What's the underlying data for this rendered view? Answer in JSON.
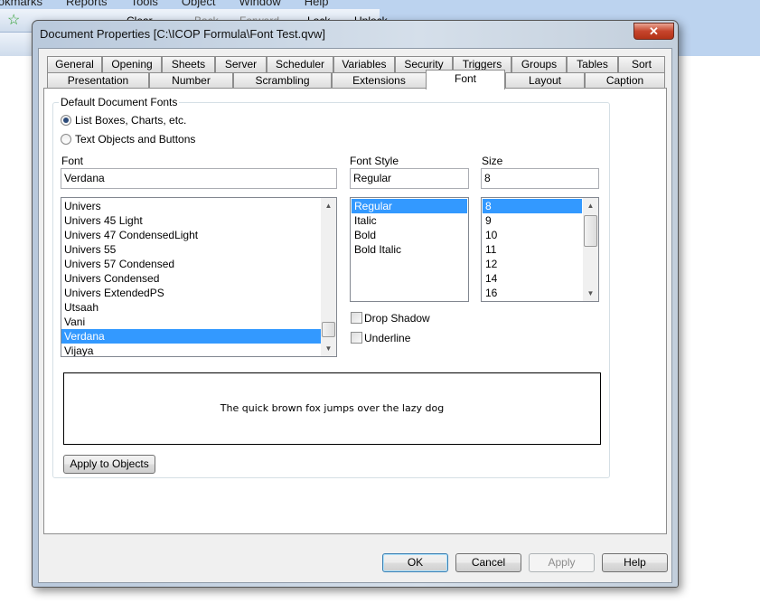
{
  "app": {
    "menu": [
      "Bookmarks",
      "Reports",
      "Tools",
      "Object",
      "Window",
      "Help"
    ],
    "toolbar": {
      "clear": "Clear",
      "back": "Back",
      "forward": "Forward",
      "lock": "Lock",
      "unlock": "Unlock"
    }
  },
  "dialog": {
    "title": "Document Properties [C:\\ICOP Formula\\Font Test.qvw]",
    "close_glyph": "✕",
    "tabs_row1": [
      "General",
      "Opening",
      "Sheets",
      "Server",
      "Scheduler",
      "Variables",
      "Security",
      "Triggers",
      "Groups",
      "Tables",
      "Sort"
    ],
    "tabs_row2": [
      "Presentation",
      "Number",
      "Scrambling",
      "Extensions",
      "Font",
      "Layout",
      "Caption"
    ],
    "active_tab": "Font",
    "font_tab": {
      "group_label": "Default Document Fonts",
      "radio_list_boxes": "List Boxes, Charts, etc.",
      "radio_text_objects": "Text Objects and Buttons",
      "font_label": "Font",
      "font_value": "Verdana",
      "font_list": [
        "Univers",
        "Univers 45 Light",
        "Univers 47 CondensedLight",
        "Univers 55",
        "Univers 57 Condensed",
        "Univers Condensed",
        "Univers ExtendedPS",
        "Utsaah",
        "Vani",
        "Verdana",
        "Vijaya"
      ],
      "font_selected": "Verdana",
      "style_label": "Font Style",
      "style_value": "Regular",
      "style_list": [
        "Regular",
        "Italic",
        "Bold",
        "Bold Italic"
      ],
      "size_label": "Size",
      "size_value": "8",
      "size_list": [
        "8",
        "9",
        "10",
        "11",
        "12",
        "14",
        "16"
      ],
      "drop_shadow": "Drop Shadow",
      "underline": "Underline",
      "preview_text": "The quick brown fox jumps over the lazy dog",
      "apply_objects": "Apply to Objects"
    },
    "buttons": {
      "ok": "OK",
      "cancel": "Cancel",
      "apply": "Apply",
      "help": "Help"
    }
  }
}
